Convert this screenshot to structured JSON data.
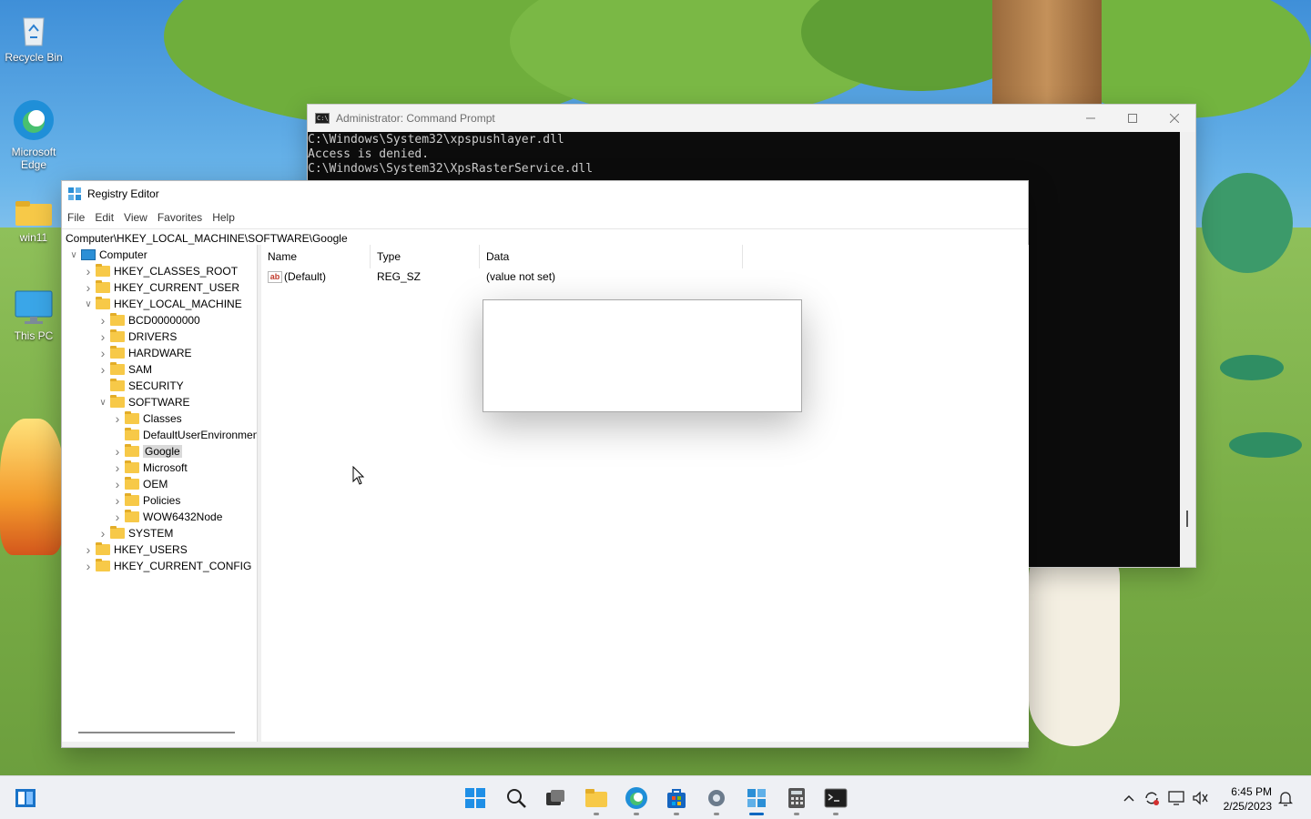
{
  "desktop": {
    "icons": [
      {
        "label": "Recycle Bin",
        "icon": "recycle-bin-icon"
      },
      {
        "label": "Microsoft Edge",
        "icon": "edge-icon"
      },
      {
        "label": "win11",
        "icon": "folder-icon"
      },
      {
        "label": "This PC",
        "icon": "monitor-icon"
      }
    ]
  },
  "cmd": {
    "title": "Administrator: Command Prompt",
    "icon": "cmd-icon",
    "lines": [
      "C:\\Windows\\System32\\xpspushlayer.dll",
      "Access is denied.",
      "C:\\Windows\\System32\\XpsRasterService.dll"
    ]
  },
  "regedit": {
    "title": "Registry Editor",
    "menu": [
      "File",
      "Edit",
      "View",
      "Favorites",
      "Help"
    ],
    "address": "Computer\\HKEY_LOCAL_MACHINE\\SOFTWARE\\Google",
    "tree": [
      {
        "label": "Computer",
        "level": 0,
        "expand": "v",
        "icon": "computer-icon"
      },
      {
        "label": "HKEY_CLASSES_ROOT",
        "level": 1,
        "expand": ">",
        "icon": "folder-icon"
      },
      {
        "label": "HKEY_CURRENT_USER",
        "level": 1,
        "expand": ">",
        "icon": "folder-icon"
      },
      {
        "label": "HKEY_LOCAL_MACHINE",
        "level": 1,
        "expand": "v",
        "icon": "folder-icon"
      },
      {
        "label": "BCD00000000",
        "level": 2,
        "expand": ">",
        "icon": "folder-icon"
      },
      {
        "label": "DRIVERS",
        "level": 2,
        "expand": ">",
        "icon": "folder-icon"
      },
      {
        "label": "HARDWARE",
        "level": 2,
        "expand": ">",
        "icon": "folder-icon"
      },
      {
        "label": "SAM",
        "level": 2,
        "expand": ">",
        "icon": "folder-icon"
      },
      {
        "label": "SECURITY",
        "level": 2,
        "expand": "",
        "icon": "folder-icon"
      },
      {
        "label": "SOFTWARE",
        "level": 2,
        "expand": "v",
        "icon": "folder-icon"
      },
      {
        "label": "Classes",
        "level": 3,
        "expand": ">",
        "icon": "folder-icon"
      },
      {
        "label": "DefaultUserEnvironment",
        "level": 3,
        "expand": "",
        "icon": "folder-icon"
      },
      {
        "label": "Google",
        "level": 3,
        "expand": ">",
        "icon": "folder-icon",
        "selected": true
      },
      {
        "label": "Microsoft",
        "level": 3,
        "expand": ">",
        "icon": "folder-icon"
      },
      {
        "label": "OEM",
        "level": 3,
        "expand": ">",
        "icon": "folder-icon"
      },
      {
        "label": "Policies",
        "level": 3,
        "expand": ">",
        "icon": "folder-icon"
      },
      {
        "label": "WOW6432Node",
        "level": 3,
        "expand": ">",
        "icon": "folder-icon"
      },
      {
        "label": "SYSTEM",
        "level": 2,
        "expand": ">",
        "icon": "folder-icon"
      },
      {
        "label": "HKEY_USERS",
        "level": 1,
        "expand": ">",
        "icon": "folder-icon"
      },
      {
        "label": "HKEY_CURRENT_CONFIG",
        "level": 1,
        "expand": ">",
        "icon": "folder-icon"
      }
    ],
    "columns": [
      "Name",
      "Type",
      "Data"
    ],
    "values": [
      {
        "name": "(Default)",
        "type": "REG_SZ",
        "data": "(value not set)",
        "icon": "string-value-icon"
      }
    ]
  },
  "taskbar": {
    "buttons": [
      {
        "name": "widgets-icon"
      },
      {
        "name": "start-icon"
      },
      {
        "name": "search-icon"
      },
      {
        "name": "task-view-icon"
      },
      {
        "name": "file-explorer-icon",
        "running": true
      },
      {
        "name": "edge-icon",
        "running": true
      },
      {
        "name": "store-icon",
        "running": true
      },
      {
        "name": "settings-icon",
        "running": true
      },
      {
        "name": "registry-editor-icon",
        "running": true,
        "active": true
      },
      {
        "name": "calculator-icon",
        "running": true
      },
      {
        "name": "terminal-icon",
        "running": true
      }
    ],
    "tray": {
      "icons": [
        "chevron-up-icon",
        "sync-icon",
        "network-icon",
        "volume-icon",
        "notification-icon"
      ],
      "time": "6:45 PM",
      "date": "2/25/2023"
    }
  },
  "colors": {
    "accent": "#0067c0",
    "cmd_background": "#0c0c0c",
    "folder": "#f7c948"
  }
}
